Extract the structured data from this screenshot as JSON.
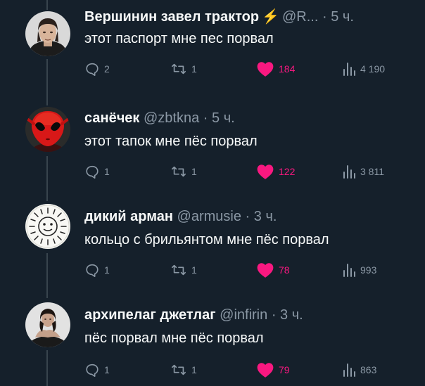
{
  "posts": [
    {
      "name": "Вершинин завел трактор",
      "has_bolt": true,
      "handle": "@R...",
      "time": "5 ч.",
      "text": "этот паспорт мне пес порвал",
      "replies": "2",
      "retweets": "1",
      "likes": "184",
      "views": "4 190"
    },
    {
      "name": "санёчек",
      "handle": "@zbtkna",
      "time": "5 ч.",
      "text": "этот тапок мне пёс порвал",
      "replies": "1",
      "retweets": "1",
      "likes": "122",
      "views": "3 811"
    },
    {
      "name": "дикий арман",
      "handle": "@armusie",
      "time": "3 ч.",
      "text": "кольцо с брильянтом мне пёс порвал",
      "replies": "1",
      "retweets": "1",
      "likes": "78",
      "views": "993"
    },
    {
      "name": "архипелаг джетлаг",
      "handle": "@infirin",
      "time": "3 ч.",
      "text": "пёс порвал мне пёс порвал",
      "replies": "1",
      "retweets": "1",
      "likes": "79",
      "views": "863"
    }
  ],
  "separator": "·",
  "bolt_symbol": "⚡",
  "icons": {
    "reply": "reply-icon",
    "retweet": "retweet-icon",
    "like": "heart-icon",
    "views": "views-icon",
    "bolt": "lightning-icon"
  },
  "colors": {
    "background": "#15202b",
    "text": "#f7f9f9",
    "muted": "#8b98a5",
    "like": "#f91880",
    "bolt": "#f4c21b"
  }
}
